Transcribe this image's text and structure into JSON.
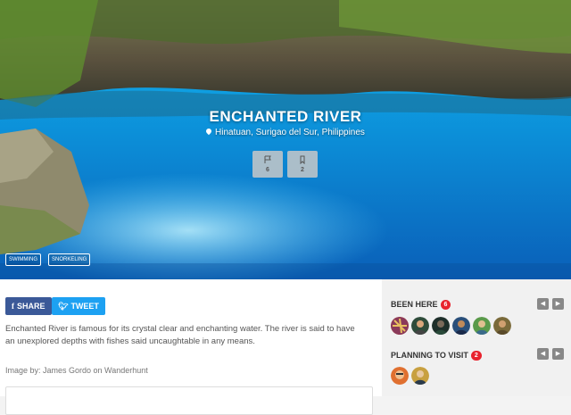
{
  "hero": {
    "title": "ENCHANTED RIVER",
    "location": "Hinatuan, Surigao del Sur, Philippines",
    "stats": [
      {
        "icon": "flag-icon",
        "count": "6"
      },
      {
        "icon": "bookmark-icon",
        "count": "2"
      }
    ],
    "tags": [
      "SWIMMING",
      "SNORKELING"
    ]
  },
  "share": {
    "share_label": "SHARE",
    "tweet_label": "TWEET"
  },
  "description": "Enchanted River is famous for its crystal clear and enchanting water. The river is said to have an unexplored depths with fishes said uncaughtable in any means.",
  "credit": "Image by: James Gordo on Wanderhunt",
  "sidebar": {
    "been_here": {
      "title": "BEEN HERE",
      "count": "6"
    },
    "planning": {
      "title": "PLANNING TO VISIT",
      "count": "2"
    }
  },
  "colors": {
    "facebook": "#3b5998",
    "twitter": "#1da1f2",
    "badge": "#e8232e",
    "water": "#0b8fd8"
  }
}
